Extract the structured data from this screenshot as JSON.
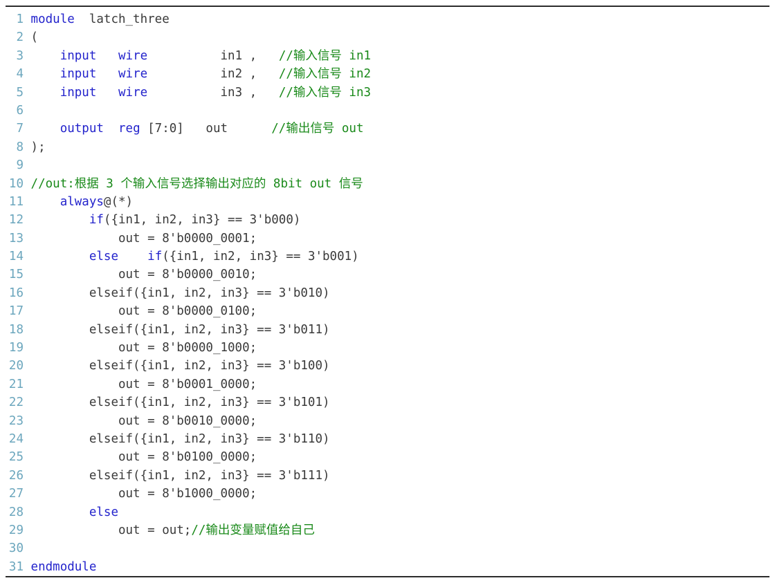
{
  "listing": {
    "language": "verilog",
    "colors": {
      "keyword": "#2323cc",
      "comment": "#1a8a1a",
      "text": "#3a3a3a",
      "line_number": "#6ba6bd",
      "rule": "#2b2b2b",
      "background": "#ffffff"
    },
    "first_line_number": 1,
    "total_lines": 31,
    "lines": [
      {
        "n": "1",
        "tokens": [
          {
            "t": "kw",
            "v": "module"
          },
          {
            "t": "plain",
            "v": "  latch_three"
          }
        ]
      },
      {
        "n": "2",
        "tokens": [
          {
            "t": "plain",
            "v": "("
          }
        ]
      },
      {
        "n": "3",
        "tokens": [
          {
            "t": "plain",
            "v": "    "
          },
          {
            "t": "kw",
            "v": "input"
          },
          {
            "t": "plain",
            "v": "   "
          },
          {
            "t": "kw",
            "v": "wire"
          },
          {
            "t": "plain",
            "v": "          in1 ,   "
          },
          {
            "t": "cmt",
            "v": "//输入信号 in1"
          }
        ]
      },
      {
        "n": "4",
        "tokens": [
          {
            "t": "plain",
            "v": "    "
          },
          {
            "t": "kw",
            "v": "input"
          },
          {
            "t": "plain",
            "v": "   "
          },
          {
            "t": "kw",
            "v": "wire"
          },
          {
            "t": "plain",
            "v": "          in2 ,   "
          },
          {
            "t": "cmt",
            "v": "//输入信号 in2"
          }
        ]
      },
      {
        "n": "5",
        "tokens": [
          {
            "t": "plain",
            "v": "    "
          },
          {
            "t": "kw",
            "v": "input"
          },
          {
            "t": "plain",
            "v": "   "
          },
          {
            "t": "kw",
            "v": "wire"
          },
          {
            "t": "plain",
            "v": "          in3 ,   "
          },
          {
            "t": "cmt",
            "v": "//输入信号 in3"
          }
        ]
      },
      {
        "n": "6",
        "tokens": []
      },
      {
        "n": "7",
        "tokens": [
          {
            "t": "plain",
            "v": "    "
          },
          {
            "t": "kw",
            "v": "output"
          },
          {
            "t": "plain",
            "v": "  "
          },
          {
            "t": "kw",
            "v": "reg"
          },
          {
            "t": "plain",
            "v": " [7:0]   out      "
          },
          {
            "t": "cmt",
            "v": "//输出信号 out"
          }
        ]
      },
      {
        "n": "8",
        "tokens": [
          {
            "t": "plain",
            "v": ");"
          }
        ]
      },
      {
        "n": "9",
        "tokens": []
      },
      {
        "n": "10",
        "tokens": [
          {
            "t": "cmt",
            "v": "//out:根据 3 个输入信号选择输出对应的 8bit out 信号"
          }
        ]
      },
      {
        "n": "11",
        "tokens": [
          {
            "t": "plain",
            "v": "    "
          },
          {
            "t": "kw",
            "v": "always"
          },
          {
            "t": "plain",
            "v": "@(*)"
          }
        ]
      },
      {
        "n": "12",
        "tokens": [
          {
            "t": "plain",
            "v": "        "
          },
          {
            "t": "kw",
            "v": "if"
          },
          {
            "t": "plain",
            "v": "({in1, in2, in3} == 3'b000)"
          }
        ]
      },
      {
        "n": "13",
        "tokens": [
          {
            "t": "plain",
            "v": "            out = 8'b0000_0001;"
          }
        ]
      },
      {
        "n": "14",
        "tokens": [
          {
            "t": "plain",
            "v": "        "
          },
          {
            "t": "kw",
            "v": "else"
          },
          {
            "t": "plain",
            "v": "    "
          },
          {
            "t": "kw",
            "v": "if"
          },
          {
            "t": "plain",
            "v": "({in1, in2, in3} == 3'b001)"
          }
        ]
      },
      {
        "n": "15",
        "tokens": [
          {
            "t": "plain",
            "v": "            out = 8'b0000_0010;"
          }
        ]
      },
      {
        "n": "16",
        "tokens": [
          {
            "t": "plain",
            "v": "        elseif({in1, in2, in3} == 3'b010)"
          }
        ]
      },
      {
        "n": "17",
        "tokens": [
          {
            "t": "plain",
            "v": "            out = 8'b0000_0100;"
          }
        ]
      },
      {
        "n": "18",
        "tokens": [
          {
            "t": "plain",
            "v": "        elseif({in1, in2, in3} == 3'b011)"
          }
        ]
      },
      {
        "n": "19",
        "tokens": [
          {
            "t": "plain",
            "v": "            out = 8'b0000_1000;"
          }
        ]
      },
      {
        "n": "20",
        "tokens": [
          {
            "t": "plain",
            "v": "        elseif({in1, in2, in3} == 3'b100)"
          }
        ]
      },
      {
        "n": "21",
        "tokens": [
          {
            "t": "plain",
            "v": "            out = 8'b0001_0000;"
          }
        ]
      },
      {
        "n": "22",
        "tokens": [
          {
            "t": "plain",
            "v": "        elseif({in1, in2, in3} == 3'b101)"
          }
        ]
      },
      {
        "n": "23",
        "tokens": [
          {
            "t": "plain",
            "v": "            out = 8'b0010_0000;"
          }
        ]
      },
      {
        "n": "24",
        "tokens": [
          {
            "t": "plain",
            "v": "        elseif({in1, in2, in3} == 3'b110)"
          }
        ]
      },
      {
        "n": "25",
        "tokens": [
          {
            "t": "plain",
            "v": "            out = 8'b0100_0000;"
          }
        ]
      },
      {
        "n": "26",
        "tokens": [
          {
            "t": "plain",
            "v": "        elseif({in1, in2, in3} == 3'b111)"
          }
        ]
      },
      {
        "n": "27",
        "tokens": [
          {
            "t": "plain",
            "v": "            out = 8'b1000_0000;"
          }
        ]
      },
      {
        "n": "28",
        "tokens": [
          {
            "t": "plain",
            "v": "        "
          },
          {
            "t": "kw",
            "v": "else"
          }
        ]
      },
      {
        "n": "29",
        "tokens": [
          {
            "t": "plain",
            "v": "            out = out;"
          },
          {
            "t": "cmt",
            "v": "//输出变量赋值给自己"
          }
        ]
      },
      {
        "n": "30",
        "tokens": []
      },
      {
        "n": "31",
        "tokens": [
          {
            "t": "kw",
            "v": "endmodule"
          }
        ]
      }
    ]
  }
}
